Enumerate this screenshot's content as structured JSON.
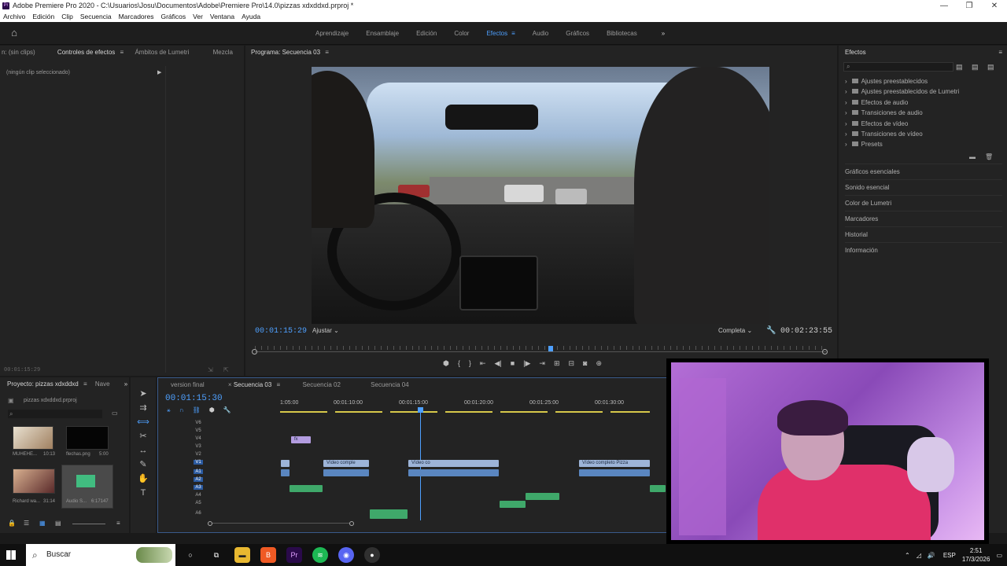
{
  "titlebar": {
    "title": "Adobe Premiere Pro 2020 - C:\\Usuarios\\Josu\\Documentos\\Adobe\\Premiere Pro\\14.0\\pizzas xdxddxd.prproj *",
    "min": "—",
    "max": "❐",
    "close": "✕"
  },
  "menu": [
    "Archivo",
    "Edición",
    "Clip",
    "Secuencia",
    "Marcadores",
    "Gráficos",
    "Ver",
    "Ventana",
    "Ayuda"
  ],
  "workspaces": {
    "tabs": [
      "Aprendizaje",
      "Ensamblaje",
      "Edición",
      "Color",
      "Efectos",
      "Audio",
      "Gráficos",
      "Bibliotecas"
    ],
    "active": "Efectos",
    "more": "»"
  },
  "effect_controls": {
    "tabs": [
      "n: (sin clips)",
      "Controles de efectos",
      "Ámbitos de Lumetri",
      "Mezcla"
    ],
    "no_clip": "(ningún clip seleccionado)",
    "timecode": "00:01:15:29"
  },
  "program": {
    "title": "Programa: Secuencia 03",
    "timecode_current": "00:01:15:29",
    "timecode_duration": "00:02:23:55",
    "fit": "Ajustar",
    "quality": "Completa",
    "playhead_fraction": 0.52
  },
  "effects": {
    "title": "Efectos",
    "items": [
      "Ajustes preestablecidos",
      "Ajustes preestablecidos de Lumetri",
      "Efectos de audio",
      "Transiciones de audio",
      "Efectos de vídeo",
      "Transiciones de vídeo",
      "Presets"
    ],
    "sections": [
      "Gráficos esenciales",
      "Sonido esencial",
      "Color de Lumetri",
      "Marcadores",
      "Historial",
      "Información"
    ]
  },
  "project": {
    "tabs": [
      "Proyecto: pizzas xdxddxd",
      "Nave"
    ],
    "file": "pizzas xdxddxd.prproj",
    "items": [
      {
        "name": "MUHEHE...",
        "dur": "10:13"
      },
      {
        "name": "flechas.png",
        "dur": "5:00"
      },
      {
        "name": "Richard wa...",
        "dur": "31:14"
      },
      {
        "name": "Audio S...",
        "dur": "6:17147"
      }
    ]
  },
  "timeline": {
    "tabs": [
      "version final",
      "Secuencia 03",
      "Secuencia 02",
      "Secuencia 04"
    ],
    "active": "Secuencia 03",
    "timecode": "00:01:15:30",
    "ruler": [
      "1:05:00",
      "00:01:10:00",
      "00:01:15:00",
      "00:01:20:00",
      "00:01:25:00",
      "00:01:30:00"
    ],
    "video_tracks": [
      "V6",
      "V5",
      "V4",
      "V3",
      "V2",
      "V1"
    ],
    "audio_tracks": [
      "A1",
      "A2",
      "A3",
      "A4",
      "A5",
      "A6"
    ],
    "clips": {
      "v1a": "Vídeo comple",
      "v1b": "Vídeo co",
      "v1c": "Vídeo completo Pizza",
      "v4": "fx"
    }
  },
  "taskbar": {
    "search": "Buscar",
    "lang": "ESP",
    "time": "2:51",
    "date": "17/3/2026"
  }
}
